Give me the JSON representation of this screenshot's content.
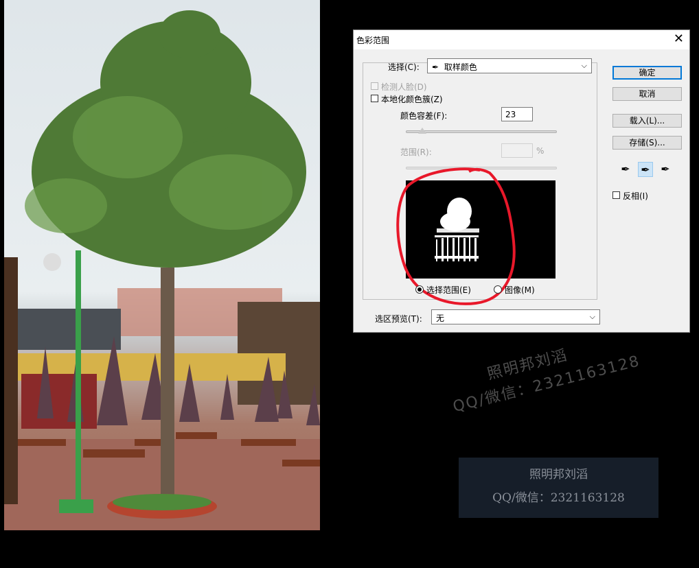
{
  "dialog": {
    "title": "色彩范围",
    "close_label": "✕",
    "select_label": "选择(C):",
    "select_value": "取样颜色",
    "detect_faces_label": "检测人脸(D)",
    "localized_label": "本地化颜色簇(Z)",
    "fuzziness_label": "颜色容差(F):",
    "fuzziness_value": "23",
    "range_label": "范围(R):",
    "range_unit": "%",
    "radio_selection": "选择范围(E)",
    "radio_image": "图像(M)",
    "preview_label": "选区预览(T):",
    "preview_value": "无",
    "chevron_icon": "chevron-down-icon",
    "buttons": {
      "ok": "确定",
      "cancel": "取消",
      "load": "载入(L)...",
      "save": "存储(S)..."
    },
    "invert_label": "反相(I)",
    "eyedroppers": [
      "eyedropper-icon",
      "eyedropper-plus-icon",
      "eyedropper-minus-icon"
    ]
  },
  "watermark": {
    "line1": "照明邦刘滔",
    "line2": "QQ/微信：2321163128",
    "box_line1": "照明邦刘滔",
    "box_line2": "QQ/微信：2321163128"
  },
  "colors": {
    "accent": "#0078d7",
    "annotation": "#e8182a"
  }
}
